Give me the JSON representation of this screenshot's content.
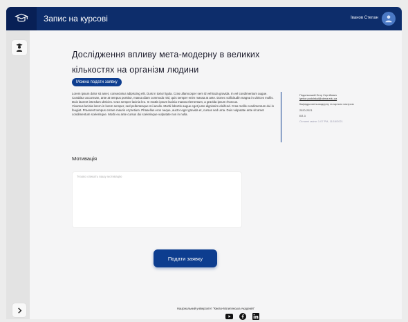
{
  "header": {
    "app_title": "Запис на курсові",
    "user_name": "Іванов Степан"
  },
  "course": {
    "title": "Дослідження впливу мета-модерну в великих кількостях на організм людини",
    "status_badge": "Можна подати заявку",
    "description_p1": "Lorem ipsum dolor sit amet, consectetur adipiscing elit. Duis in tortor ligula. Cras ullamcorper sem id vehicula gravida. In vel condimentum augue. Curabitur accumsan, ante at tempus porttitor, massa diam commodo nisl, quis semper enim massa at ante. Donec sollicitudin magna in ultrices mollis. Duis laoreet interdum ultricies. Cras semper lacinia leo. In mattis ipsum lacinia massa elementum, a gravida ipsum rhoncus.",
    "description_p2": "Vivamus lacinia lorem in lorem semper, sed pellentesque mi iaculis. Morbi lobortis augue eget justo dignissim eleifend. Cras mollis condimentum dui in feugiat. Praesent tempus ornare mauris et pretium. Phasellus eros neque, auctor eget gravida et, cursus sed urna. Duis vulputate ante sit amet condimentum scelerisque. Morbi eu ante cursus dui scelerisque vulputate non in nulla."
  },
  "teacher": {
    "name": "Подольський Єгор Сергійович",
    "email": "iyehor.podolskyi@ukma.edu.ua",
    "department": "Кафедра мета-модерну та гарного настрою",
    "year": "2020-2021",
    "group": "БП-3",
    "last_modified": "Останні зміни: 1:07 PM, 11/16/2021"
  },
  "motivation": {
    "label": "Мотивація",
    "placeholder": "Тезово опишіть вашу мотивацію"
  },
  "submit_label": "Подати заявку",
  "footer": {
    "university": "Національний університет \"Києво-Могилянська Академія\""
  },
  "colors": {
    "primary": "#0d2d6b",
    "accent": "#0d3d8f",
    "background": "#f5f5f6"
  },
  "icons": {
    "logo": "graduation-cap-icon",
    "sidebar": "student-icon",
    "expand": "chevron-right-icon",
    "social": [
      "youtube-icon",
      "facebook-icon",
      "linkedin-icon"
    ]
  }
}
